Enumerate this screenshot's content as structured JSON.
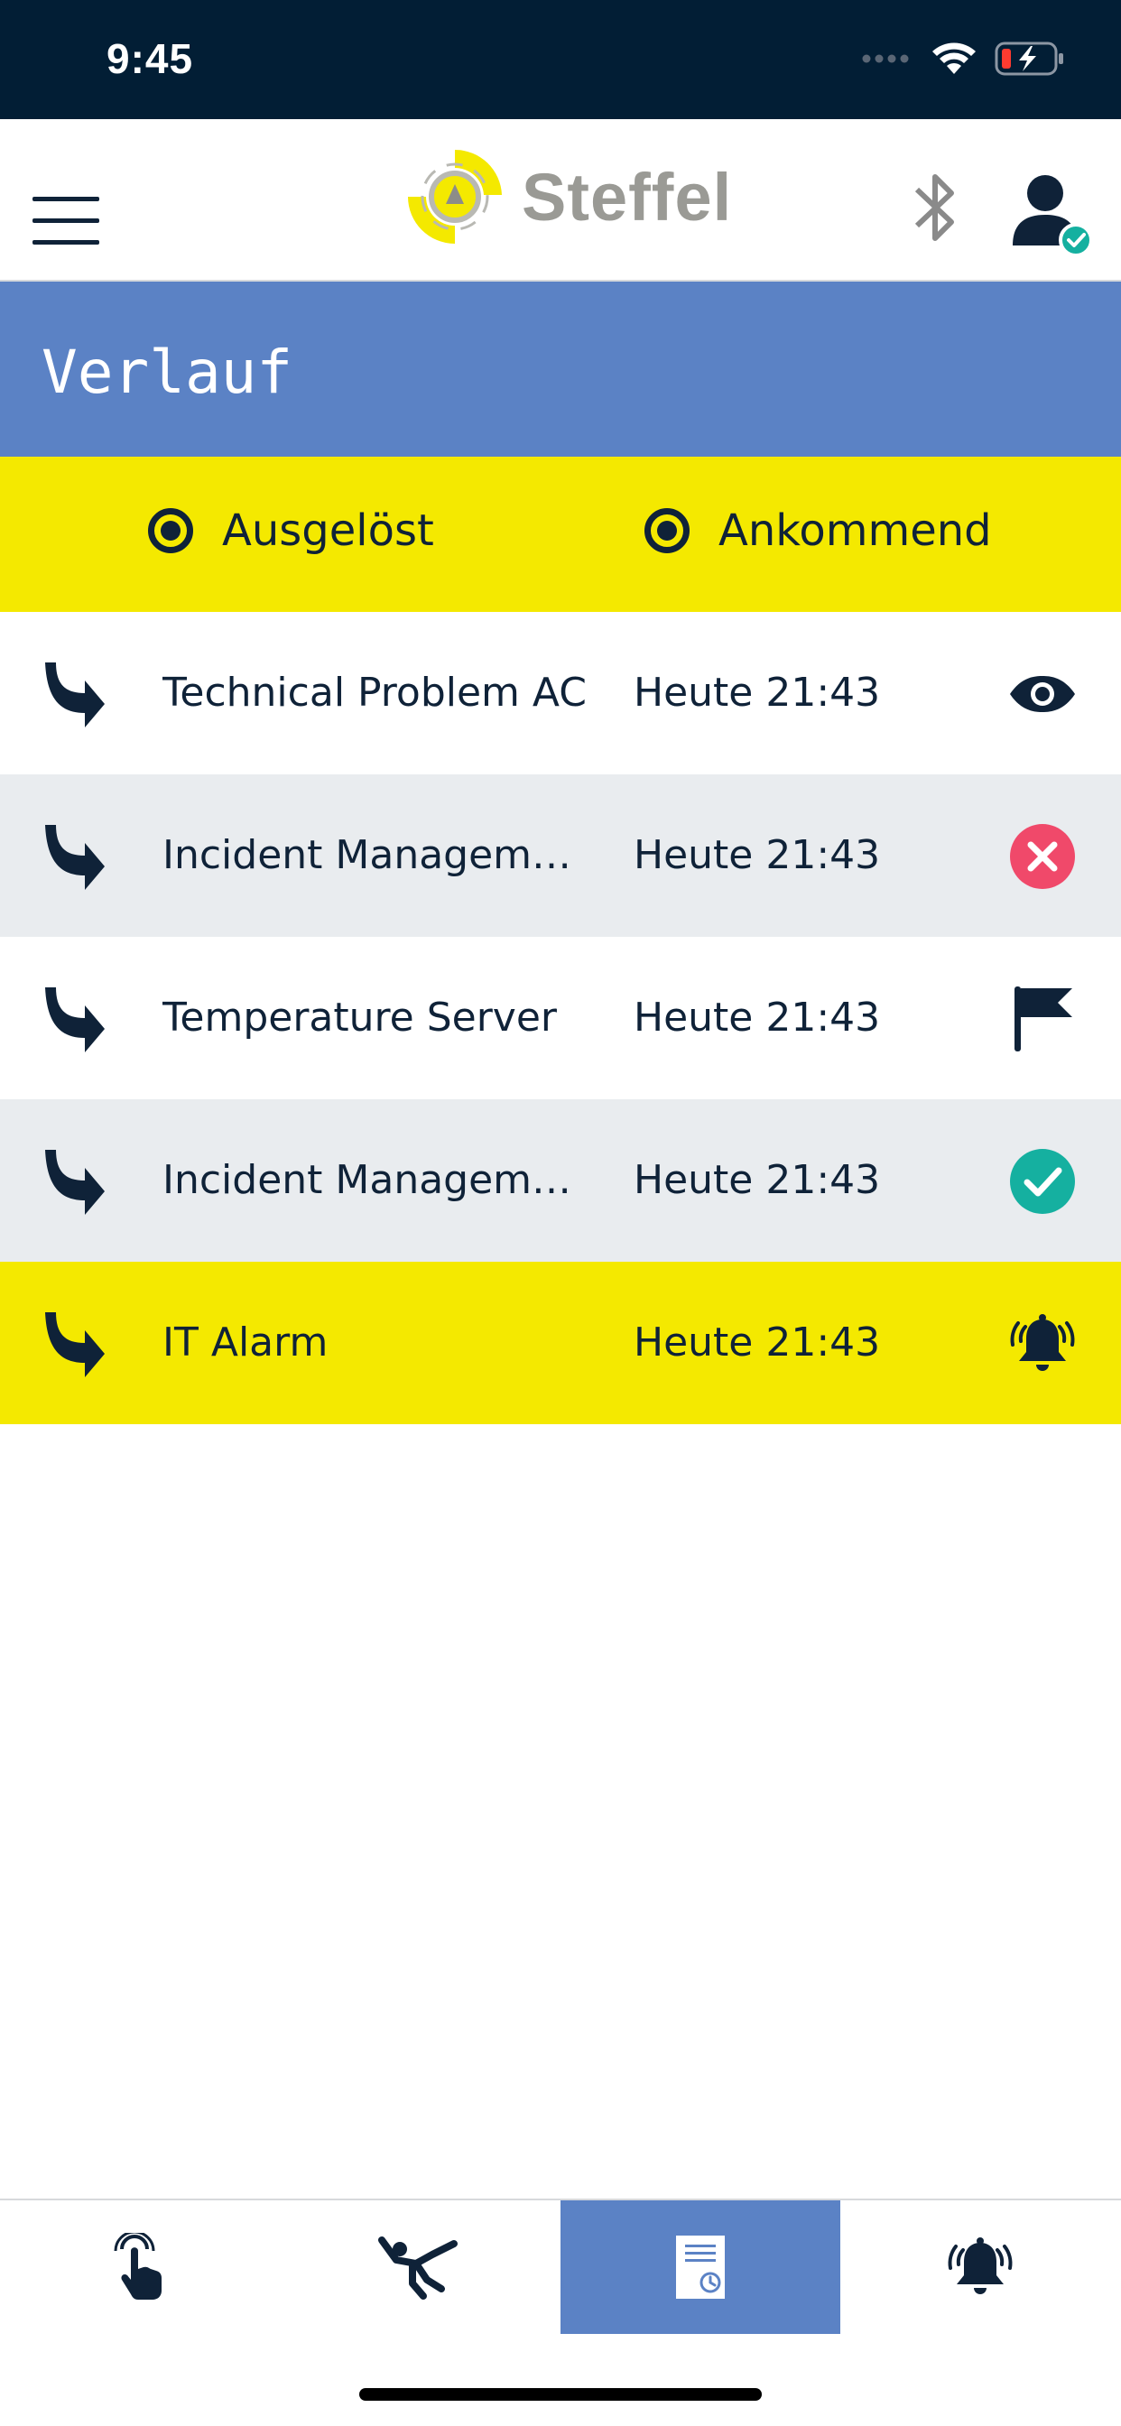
{
  "status_bar": {
    "time": "9:45"
  },
  "header": {
    "logo_text": "Steffel"
  },
  "page": {
    "title": "Verlauf"
  },
  "filters": [
    {
      "label": "Ausgelöst",
      "selected": true
    },
    {
      "label": "Ankommend",
      "selected": true
    }
  ],
  "events": [
    {
      "name": "Technical Problem AC",
      "time": "Heute 21:43",
      "status_icon": "eye-icon"
    },
    {
      "name": "Incident Management…",
      "time": "Heute 21:43",
      "status_icon": "cancelled-icon"
    },
    {
      "name": "Temperature Server",
      "time": "Heute 21:43",
      "status_icon": "flag-icon"
    },
    {
      "name": "Incident Management…",
      "time": "Heute 21:43",
      "status_icon": "checkmark-icon"
    },
    {
      "name": "IT Alarm",
      "time": "Heute 21:43",
      "status_icon": "alarm-bell-icon"
    }
  ],
  "bottom_nav": [
    {
      "icon": "touch-hand-icon",
      "active": false
    },
    {
      "icon": "falling-person-icon",
      "active": false
    },
    {
      "icon": "history-document-icon",
      "active": true
    },
    {
      "icon": "alarm-bell-icon",
      "active": false
    }
  ],
  "colors": {
    "navy": "#0f2238",
    "status_bar": "#021e35",
    "accent_blue": "#5b82c5",
    "accent_yellow": "#f4e900",
    "row_alt": "#e9ecef",
    "cancel_red": "#f0496a",
    "check_green": "#15b0a0"
  }
}
